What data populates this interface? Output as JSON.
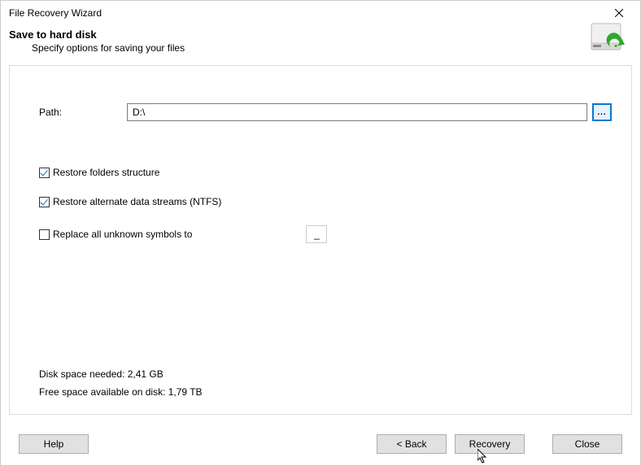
{
  "window": {
    "title": "File Recovery Wizard"
  },
  "header": {
    "title": "Save to hard disk",
    "subtitle": "Specify options for saving your files"
  },
  "path": {
    "label": "Path:",
    "value": "D:\\",
    "browse_label": "..."
  },
  "options": {
    "restore_folders": {
      "label": "Restore folders structure",
      "checked": true
    },
    "restore_ads": {
      "label": "Restore alternate data streams (NTFS)",
      "checked": true
    },
    "replace_symbols": {
      "label": "Replace all unknown symbols to",
      "checked": false,
      "value": "_"
    }
  },
  "info": {
    "disk_needed": "Disk space needed: 2,41 GB",
    "free_space": "Free space available on disk: 1,79 TB"
  },
  "buttons": {
    "help": "Help",
    "back": "< Back",
    "recovery": "Recovery",
    "close": "Close"
  }
}
